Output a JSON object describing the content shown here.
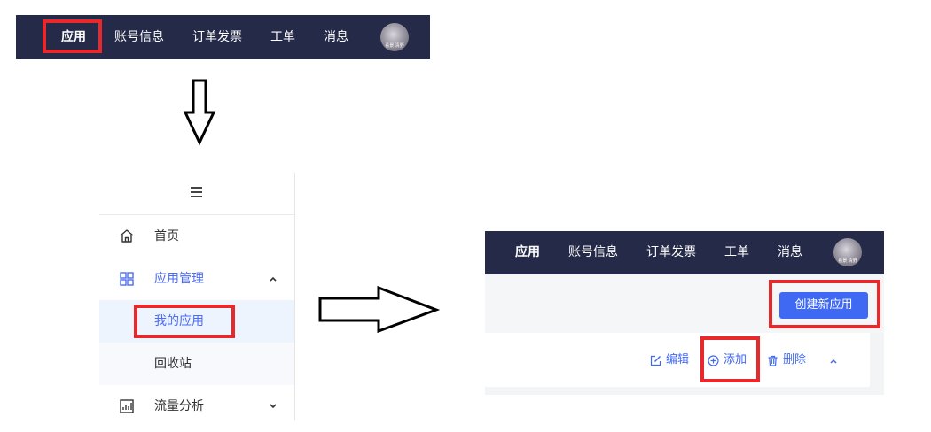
{
  "colors": {
    "navbar_bg": "#242a47",
    "highlight": "#e8292b",
    "accent": "#3f69f3",
    "menu_active_bg": "#eef4fd"
  },
  "top_nav": {
    "items": [
      "应用",
      "账号信息",
      "订单发票",
      "工单",
      "消息"
    ],
    "active_index": 0,
    "avatar_caption": "看景 清野"
  },
  "sidebar": {
    "collapse_icon": "hamburger-icon",
    "items": [
      {
        "label": "首页",
        "icon": "home-icon"
      },
      {
        "label": "应用管理",
        "icon": "grid-icon",
        "expanded": true
      },
      {
        "label": "我的应用",
        "sub": true,
        "active": true
      },
      {
        "label": "回收站",
        "sub": true
      },
      {
        "label": "流量分析",
        "icon": "chart-icon",
        "expanded": false
      }
    ]
  },
  "panel3": {
    "nav_items": [
      "应用",
      "账号信息",
      "订单发票",
      "工单",
      "消息"
    ],
    "create_button": "创建新应用",
    "actions": [
      {
        "label": "编辑",
        "icon": "edit-icon"
      },
      {
        "label": "添加",
        "icon": "plus-circle-icon"
      },
      {
        "label": "删除",
        "icon": "trash-icon"
      }
    ],
    "collapse_icon": "chevron-up-icon"
  }
}
